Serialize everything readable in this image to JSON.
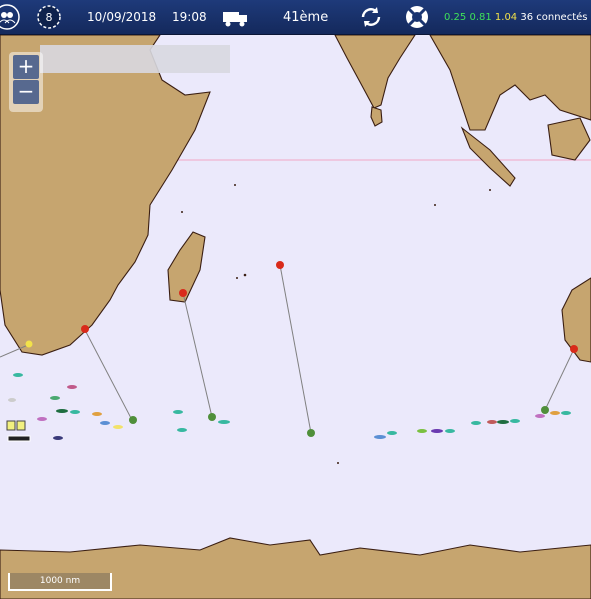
{
  "topbar": {
    "date": "10/09/2018",
    "time": "19:08",
    "rank": "41ème",
    "wind_badge": "8",
    "stat_1": "0.25",
    "stat_2": "0.81",
    "stat_3": "1.04",
    "connected": "36 connectés",
    "colors": {
      "stat_1": "#3ee05a",
      "stat_2": "#3ee05a",
      "stat_3": "#f2e24a",
      "bar": "#1a3470"
    }
  },
  "icons": [
    "users-icon",
    "wind-badge-icon",
    "truck-icon",
    "refresh-icon",
    "lifebuoy-icon"
  ],
  "map": {
    "zoom_in": "+",
    "zoom_out": "−",
    "scale_label": "1000 nm",
    "colors": {
      "sea": "#ebe9fb",
      "land": "#c6a56f",
      "coast": "#3a1e12",
      "route": "#808080",
      "marker_red": "#d92a1a",
      "marker_green": "#4f8f3a"
    }
  }
}
